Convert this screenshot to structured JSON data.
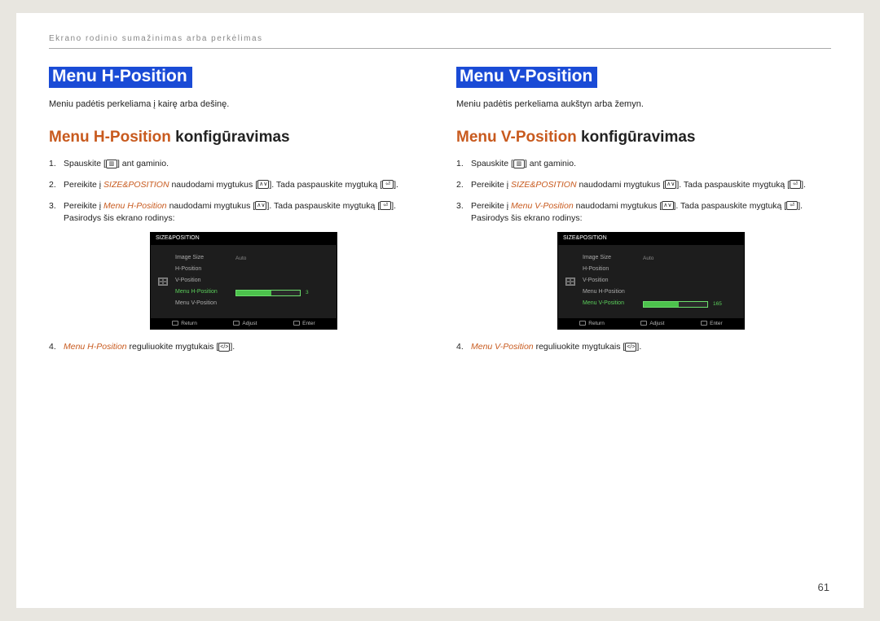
{
  "header": "Ekrano rodinio sumažinimas arba perkėlimas",
  "pageNumber": "61",
  "left": {
    "title": "Menu H-Position",
    "desc": "Meniu padėtis perkeliama į kairę arba dešinę.",
    "subOrange": "Menu H-Position",
    "subRest": " konfigūravimas",
    "step1a": "Spauskite [",
    "step1b": "] ant gaminio.",
    "step2a": "Pereikite į ",
    "step2link": "SIZE&POSITION",
    "step2b": " naudodami mygtukus [",
    "step2c": "]. Tada paspauskite mygtuką [",
    "step2d": "].",
    "step3a": "Pereikite į ",
    "step3link": "Menu H-Position",
    "step3b": " naudodami mygtukus [",
    "step3c": "]. Tada paspauskite mygtuką [",
    "step3d": "]. Pasirodys šis ekrano rodinys:",
    "osd": {
      "title": "SIZE&POSITION",
      "r1": "Image Size",
      "r1v": "Auto",
      "r2": "H-Position",
      "r3": "V-Position",
      "r4": "Menu H-Position",
      "r4v": "3",
      "r5": "Menu V-Position",
      "fReturn": "Return",
      "fAdjust": "Adjust",
      "fEnter": "Enter"
    },
    "step4link": "Menu H-Position",
    "step4b": " reguliuokite mygtukais [",
    "step4c": "]."
  },
  "right": {
    "title": "Menu V-Position",
    "desc": "Meniu padėtis perkeliama aukštyn arba žemyn.",
    "subOrange": "Menu V-Position",
    "subRest": " konfigūravimas",
    "step1a": "Spauskite [",
    "step1b": "] ant gaminio.",
    "step2a": "Pereikite į ",
    "step2link": "SIZE&POSITION",
    "step2b": " naudodami mygtukus [",
    "step2c": "]. Tada paspauskite mygtuką [",
    "step2d": "].",
    "step3a": "Pereikite į ",
    "step3link": "Menu V-Position",
    "step3b": " naudodami mygtukus [",
    "step3c": "]. Tada paspauskite mygtuką [",
    "step3d": "]. Pasirodys šis ekrano rodinys:",
    "osd": {
      "title": "SIZE&POSITION",
      "r1": "Image Size",
      "r1v": "Auto",
      "r2": "H-Position",
      "r3": "V-Position",
      "r4": "Menu H-Position",
      "r5": "Menu V-Position",
      "r5v": "165",
      "fReturn": "Return",
      "fAdjust": "Adjust",
      "fEnter": "Enter"
    },
    "step4link": "Menu V-Position",
    "step4b": " reguliuokite mygtukais [",
    "step4c": "]."
  }
}
